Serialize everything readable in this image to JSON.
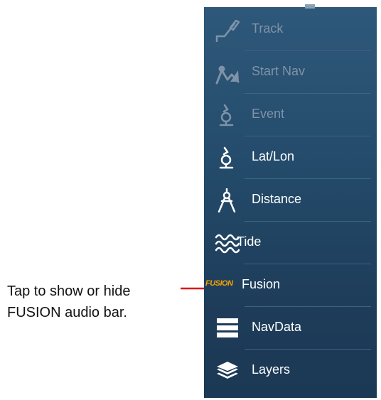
{
  "menu": {
    "items": [
      {
        "label": "Track",
        "icon": "track-icon",
        "enabled": false
      },
      {
        "label": "Start Nav",
        "icon": "start-nav-icon",
        "enabled": false
      },
      {
        "label": "Event",
        "icon": "event-icon",
        "enabled": false
      },
      {
        "label": "Lat/Lon",
        "icon": "lat-lon-icon",
        "enabled": true
      },
      {
        "label": "Distance",
        "icon": "distance-icon",
        "enabled": true
      },
      {
        "label": "Tide",
        "icon": "tide-icon",
        "enabled": true
      },
      {
        "label": "Fusion",
        "icon": "fusion-logo",
        "logo_text": "FUSION",
        "enabled": true
      },
      {
        "label": "NavData",
        "icon": "navdata-icon",
        "enabled": true
      },
      {
        "label": "Layers",
        "icon": "layers-icon",
        "enabled": true
      }
    ]
  },
  "callout": {
    "line1": "Tap to show or hide",
    "line2": "FUSION audio bar."
  },
  "colors": {
    "panel_bg": "#244b6b",
    "disabled_text": "#7e93a8",
    "enabled_text": "#ffffff",
    "fusion_logo": "#f3a200",
    "arrow": "#e01010"
  }
}
